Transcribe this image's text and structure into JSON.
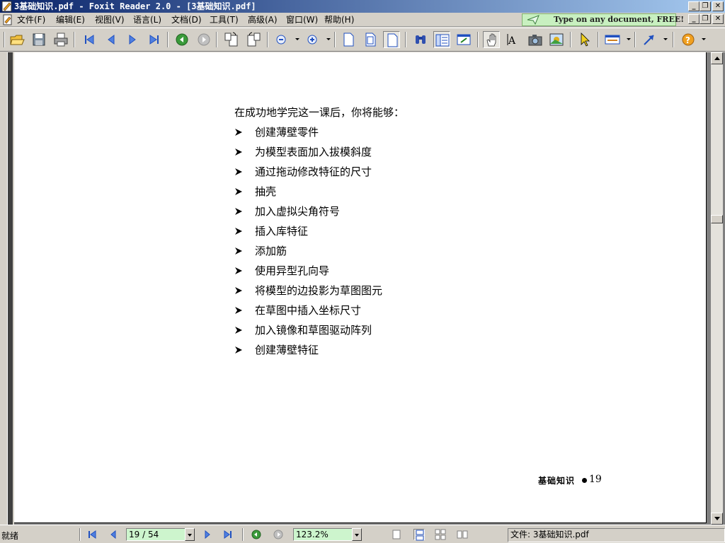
{
  "window": {
    "title": "3基础知识.pdf - Foxit Reader 2.0 - [3基础知识.pdf]",
    "minimize_glyph": "_",
    "restore_glyph": "❐",
    "close_glyph": "✕"
  },
  "menu": {
    "items": [
      "文件(F)",
      "编辑(E)",
      "视图(V)",
      "语言(L)",
      "文档(D)",
      "工具(T)",
      "高级(A)",
      "窗口(W)",
      "帮助(H)"
    ],
    "ad_text": "Type on any document, FREE!"
  },
  "toolbar": {
    "icons": [
      "open-icon",
      "save-icon",
      "print-icon",
      "first-page-icon",
      "prev-page-icon",
      "next-page-icon",
      "last-page-icon",
      "back-icon",
      "forward-icon",
      "rotate-left-icon",
      "rotate-right-icon",
      "zoom-out-icon",
      "zoom-in-icon",
      "actual-size-icon",
      "fit-page-icon",
      "fit-width-icon",
      "find-icon",
      "bookmarks-icon",
      "thumbnails-icon",
      "hand-tool-icon",
      "text-select-icon",
      "snapshot-icon",
      "image-select-icon",
      "select-icon",
      "typewriter-icon",
      "arrow-annotation-icon",
      "help-icon"
    ]
  },
  "page": {
    "intro": "在成功地学完这一课后，你将能够：",
    "objectives": [
      "创建薄壁零件",
      "为模型表面加入拔模斜度",
      "通过拖动修改特征的尺寸",
      "抽壳",
      "加入虚拟尖角符号",
      "插入库特征",
      "添加筋",
      "使用异型孔向导",
      "将模型的边投影为草图图元",
      "在草图中插入坐标尺寸",
      "加入镜像和草图驱动阵列",
      "创建薄壁特征"
    ],
    "footer_label": "基础知识",
    "footer_page": "19"
  },
  "status": {
    "ready": "就绪",
    "page_indicator": "19 / 54",
    "zoom": "123.2%",
    "file_info": "文件: 3基础知识.pdf"
  },
  "colors": {
    "titlebar_start": "#0a246a",
    "titlebar_end": "#a6caf0",
    "chrome": "#d4d0c8",
    "status_field": "#cdf5cd",
    "ad_banner": "#c8f0c0",
    "nav_green": "#3a9a3a",
    "nav_blue": "#2050c0"
  }
}
